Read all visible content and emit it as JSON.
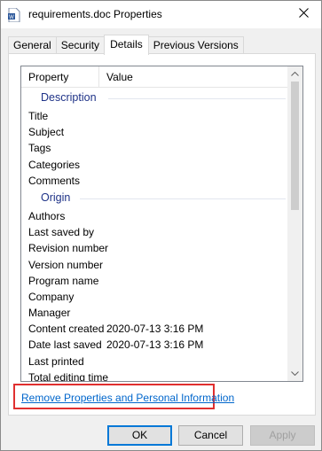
{
  "window": {
    "title": "requirements.doc Properties",
    "close_glyph": "✕"
  },
  "tabs": [
    {
      "label": "General"
    },
    {
      "label": "Security"
    },
    {
      "label": "Details"
    },
    {
      "label": "Previous Versions"
    }
  ],
  "listview": {
    "headers": {
      "property": "Property",
      "value": "Value"
    },
    "groups": [
      {
        "label": "Description",
        "rows": [
          {
            "property": "Title",
            "value": ""
          },
          {
            "property": "Subject",
            "value": ""
          },
          {
            "property": "Tags",
            "value": ""
          },
          {
            "property": "Categories",
            "value": ""
          },
          {
            "property": "Comments",
            "value": ""
          }
        ]
      },
      {
        "label": "Origin",
        "rows": [
          {
            "property": "Authors",
            "value": ""
          },
          {
            "property": "Last saved by",
            "value": ""
          },
          {
            "property": "Revision number",
            "value": ""
          },
          {
            "property": "Version number",
            "value": ""
          },
          {
            "property": "Program name",
            "value": ""
          },
          {
            "property": "Company",
            "value": ""
          },
          {
            "property": "Manager",
            "value": ""
          },
          {
            "property": "Content created",
            "value": "2020-07-13 3:16 PM"
          },
          {
            "property": "Date last saved",
            "value": "2020-07-13 3:16 PM"
          },
          {
            "property": "Last printed",
            "value": ""
          },
          {
            "property": "Total editing time",
            "value": ""
          }
        ]
      }
    ]
  },
  "link": {
    "label": "Remove Properties and Personal Information"
  },
  "buttons": {
    "ok": "OK",
    "cancel": "Cancel",
    "apply": "Apply"
  }
}
